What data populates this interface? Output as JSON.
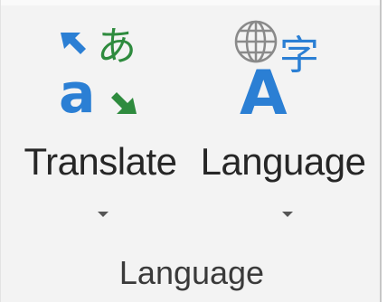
{
  "ribbon_group": {
    "label": "Language",
    "commands": [
      {
        "label": "Translate",
        "icon": "translate-icon",
        "has_dropdown": true
      },
      {
        "label": "Language",
        "icon": "language-icon",
        "has_dropdown": true
      }
    ],
    "colors": {
      "blue": "#2b7fd4",
      "green": "#2e8b3e",
      "gray": "#8a8a8a"
    },
    "icon_glyphs": {
      "translate_target": "あ",
      "translate_source": "a",
      "language_letter": "A",
      "language_char": "字"
    }
  }
}
